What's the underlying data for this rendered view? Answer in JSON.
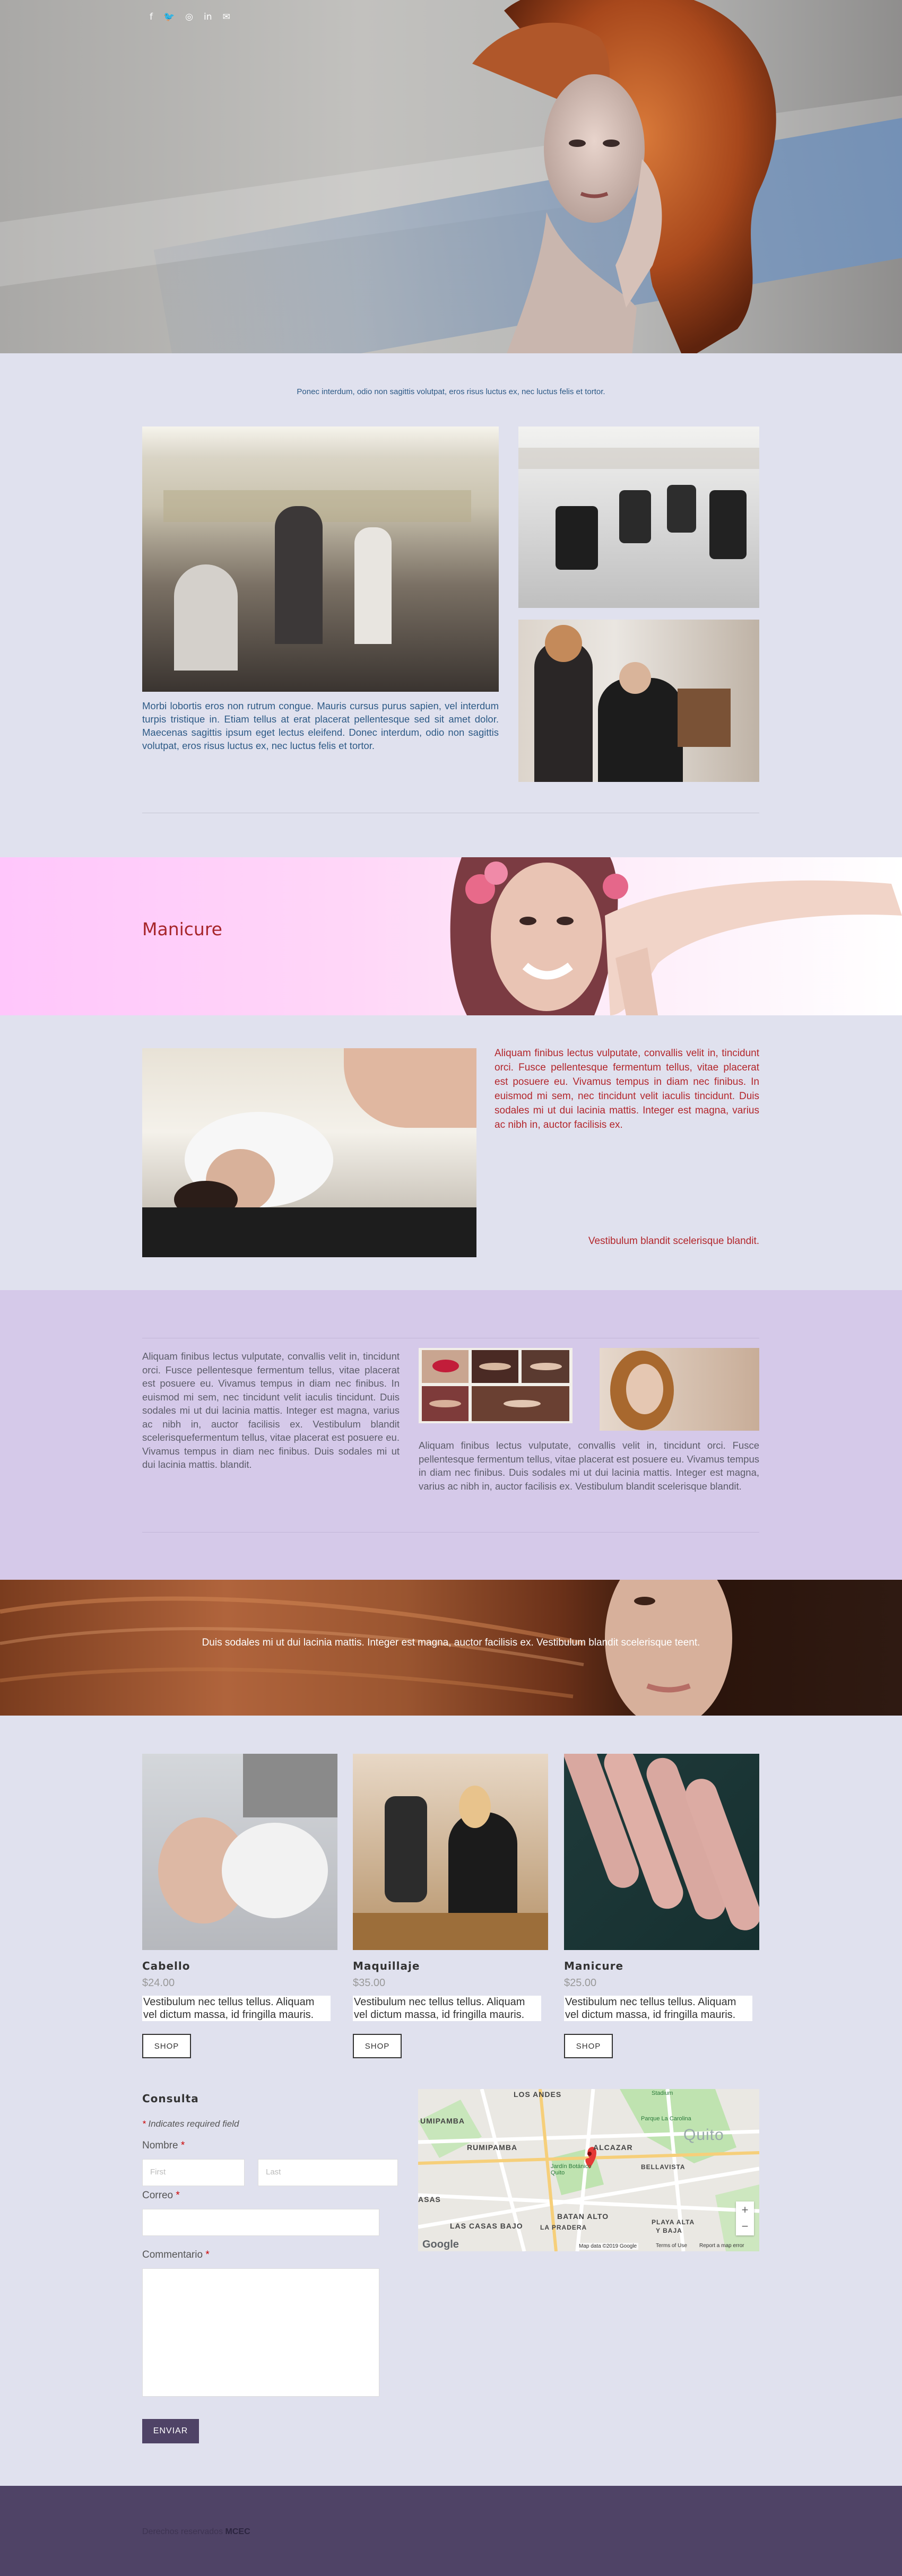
{
  "social": {
    "facebook": "f",
    "twitter": "🐦",
    "instagram": "◎",
    "linkedin": "in",
    "email": "✉"
  },
  "intro": "Ponec interdum, odio non sagittis volutpat, eros risus luctus ex, nec luctus felis et tortor.",
  "salon": {
    "description": "Morbi lobortis eros non rutrum congue. Mauris cursus purus sapien, vel interdum turpis tristique in. Etiam tellus at erat placerat pellentesque sed sit amet dolor. Maecenas sagittis ipsum eget lectus eleifend. Donec interdum, odio non sagittis volutpat, eros risus luctus ex, nec luctus felis et tortor."
  },
  "manicure": {
    "title": "Manicure"
  },
  "wash": {
    "text": "Aliquam finibus lectus vulputate, convallis velit in, tincidunt orci. Fusce pellentesque fermentum tellus, vitae placerat est posuere eu. Vivamus tempus in diam nec finibus. In euismod mi sem, nec tincidunt velit iaculis tincidunt. Duis sodales mi ut dui lacinia mattis. Integer est magna, varius ac nibh in, auctor facilisis ex.",
    "tagline": "Vestibulum blandit scelerisque blandit."
  },
  "lavender": {
    "left_text": "Aliquam finibus lectus vulputate, convallis velit in, tincidunt orci. Fusce pellentesque fermentum tellus, vitae placerat est posuere eu. Vivamus tempus in diam nec finibus. In euismod mi sem, nec tincidunt velit iaculis tincidunt. Duis sodales mi ut dui lacinia mattis. Integer est magna, varius ac nibh in, auctor facilisis ex. Vestibulum blandit scelerisquefermentum tellus, vitae placerat est posuere eu. Vivamus tempus in diam nec finibus. Duis sodales mi ut dui lacinia mattis. blandit.",
    "right_text": "Aliquam finibus lectus vulputate, convallis velit in, tincidunt orci. Fusce pellentesque fermentum tellus, vitae placerat est posuere eu. Vivamus tempus in diam nec finibus. Duis sodales mi ut dui lacinia mattis. Integer est magna, varius ac nibh in, auctor facilisis ex. Vestibulum blandit scelerisque blandit."
  },
  "hairband": {
    "text": "Duis sodales mi ut dui lacinia mattis. Integer est magna, auctor facilisis ex. Vestibulum blandit scelerisque teent."
  },
  "products": [
    {
      "title": "Cabello",
      "price": "$24.00",
      "desc": "Vestibulum nec tellus tellus. Aliquam vel dictum massa, id fringilla mauris.",
      "button": "SHOP"
    },
    {
      "title": "Maquillaje",
      "price": "$35.00",
      "desc": "Vestibulum nec tellus tellus. Aliquam vel dictum massa, id fringilla mauris.",
      "button": "SHOP"
    },
    {
      "title": "Manicure",
      "price": "$25.00",
      "desc": "Vestibulum nec tellus tellus. Aliquam vel dictum massa, id fringilla mauris.",
      "button": "SHOP"
    }
  ],
  "form": {
    "title": "Consulta",
    "required_note_star": "*",
    "required_note": " Indicates required field",
    "name_label": "Nombre",
    "first_placeholder": "First",
    "last_placeholder": "Last",
    "email_label": "Correo",
    "comment_label": "Commentario",
    "required_star": "*",
    "submit": "ENVIAR"
  },
  "map": {
    "labels": [
      "LOS ANDES",
      "UMIPAMBA",
      "RUMIPAMBA",
      "ALCAZAR",
      "BELLAVISTA",
      "Quito",
      "ASAS",
      "LAS CASAS BAJO",
      "BATAN ALTO",
      "LA PRADERA",
      "PLAYA ALTA",
      "Y BAJA"
    ],
    "places": [
      "Parque La Carolina",
      "Jardín Botánico Quito",
      "Stadium"
    ],
    "attribution": "Map data ©2019 Google",
    "terms": "Terms of Use",
    "report": "Report a map error",
    "google": "Google",
    "zoom_in": "+",
    "zoom_out": "−"
  },
  "footer": {
    "text": "Derechos reservados ",
    "brand": "MCEC"
  }
}
